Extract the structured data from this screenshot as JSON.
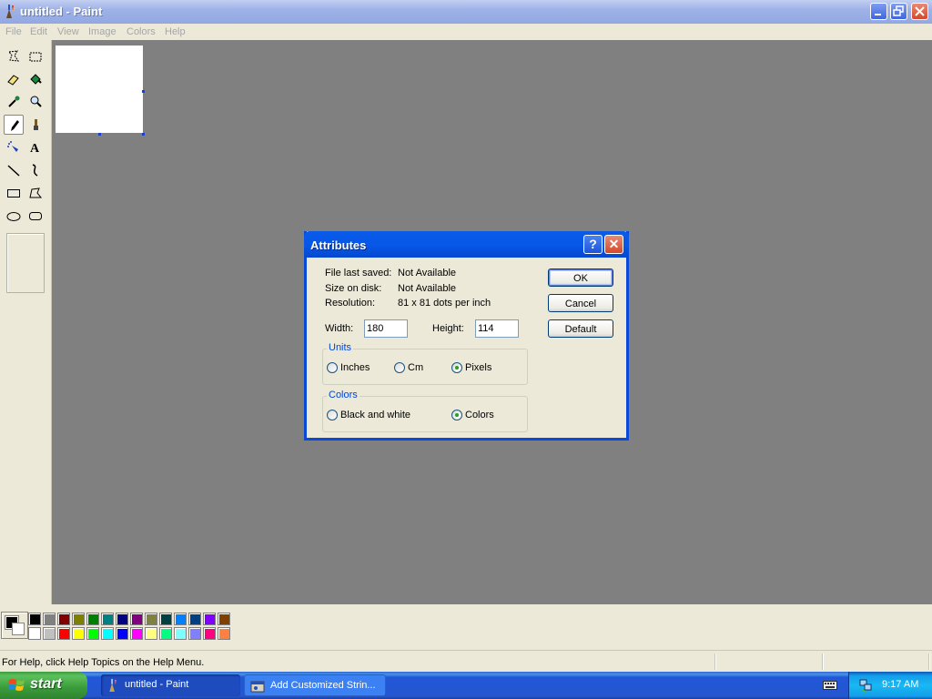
{
  "window": {
    "title": "untitled - Paint"
  },
  "menu": [
    "File",
    "Edit",
    "View",
    "Image",
    "Colors",
    "Help"
  ],
  "tools": [
    {
      "name": "free-form-select-icon"
    },
    {
      "name": "rectangle-select-icon"
    },
    {
      "name": "eraser-icon"
    },
    {
      "name": "fill-bucket-icon"
    },
    {
      "name": "color-picker-icon"
    },
    {
      "name": "magnifier-icon"
    },
    {
      "name": "pencil-icon",
      "selected": true
    },
    {
      "name": "brush-icon"
    },
    {
      "name": "airbrush-icon"
    },
    {
      "name": "text-icon"
    },
    {
      "name": "line-icon"
    },
    {
      "name": "curve-icon"
    },
    {
      "name": "rectangle-icon"
    },
    {
      "name": "polygon-icon"
    },
    {
      "name": "ellipse-icon"
    },
    {
      "name": "rounded-rectangle-icon"
    }
  ],
  "palette": {
    "foreground": "#000000",
    "background": "#ffffff",
    "row1": [
      "#000000",
      "#808080",
      "#800000",
      "#808000",
      "#008000",
      "#008080",
      "#000080",
      "#800080",
      "#808040",
      "#004040",
      "#0080ff",
      "#004080",
      "#8000ff",
      "#804000"
    ],
    "row2": [
      "#ffffff",
      "#c0c0c0",
      "#ff0000",
      "#ffff00",
      "#00ff00",
      "#00ffff",
      "#0000ff",
      "#ff00ff",
      "#ffff80",
      "#00ff80",
      "#80ffff",
      "#8080ff",
      "#ff0080",
      "#ff8040"
    ]
  },
  "status": {
    "text": "For Help, click Help Topics on the Help Menu."
  },
  "dialog": {
    "title": "Attributes",
    "help_glyph": "?",
    "close_glyph": "✕",
    "file_last_saved_label": "File last saved:",
    "file_last_saved_value": "Not Available",
    "size_on_disk_label": "Size on disk:",
    "size_on_disk_value": "Not Available",
    "resolution_label": "Resolution:",
    "resolution_value": "81 x 81 dots per inch",
    "width_label": "Width:",
    "width_value": "180",
    "height_label": "Height:",
    "height_value": "114",
    "units_title": "Units",
    "units": [
      {
        "label": "Inches",
        "checked": false
      },
      {
        "label": "Cm",
        "checked": false
      },
      {
        "label": "Pixels",
        "checked": true
      }
    ],
    "colors_title": "Colors",
    "colors": [
      {
        "label": "Black and white",
        "checked": false
      },
      {
        "label": "Colors",
        "checked": true
      }
    ],
    "ok_label": "OK",
    "cancel_label": "Cancel",
    "default_label": "Default"
  },
  "taskbar": {
    "start_label": "start",
    "tasks": [
      {
        "label": "untitled - Paint",
        "active": true
      },
      {
        "label": "Add Customized Strin...",
        "active": false
      }
    ],
    "clock": "9:17 AM"
  }
}
